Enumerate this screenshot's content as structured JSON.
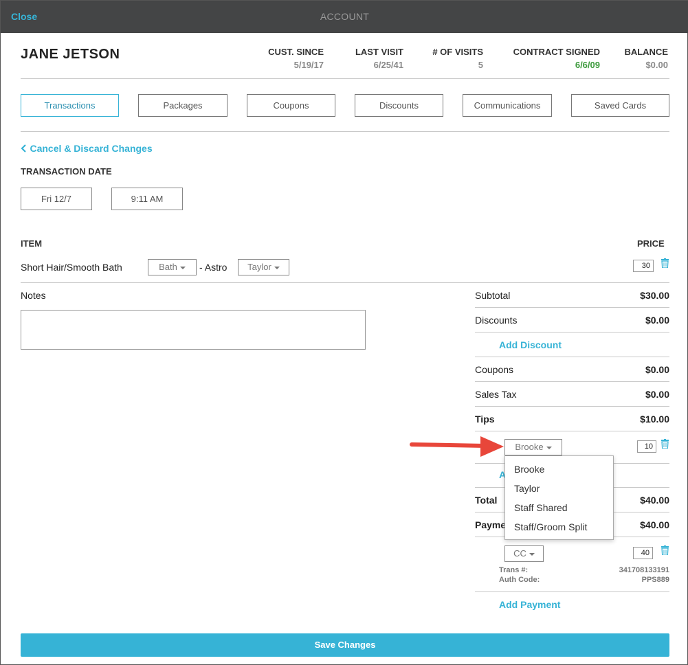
{
  "window": {
    "close_label": "Close",
    "title": "ACCOUNT"
  },
  "customer": {
    "name": "JANE JETSON",
    "stats": [
      {
        "label": "CUST. SINCE",
        "value": "5/19/17"
      },
      {
        "label": "LAST VISIT",
        "value": "6/25/41"
      },
      {
        "label": "# OF VISITS",
        "value": "5"
      },
      {
        "label": "CONTRACT SIGNED",
        "value": "6/6/09"
      },
      {
        "label": "BALANCE",
        "value": "$0.00"
      }
    ]
  },
  "tabs": [
    "Transactions",
    "Packages",
    "Coupons",
    "Discounts",
    "Communications",
    "Saved Cards"
  ],
  "active_tab": "Transactions",
  "cancel_label": "Cancel & Discard Changes",
  "transaction_date": {
    "label": "TRANSACTION DATE",
    "date": "Fri 12/7",
    "time": "9:11 AM"
  },
  "items": {
    "header_item": "ITEM",
    "header_price": "PRICE",
    "row": {
      "name": "Short Hair/Smooth Bath",
      "service": "Bath",
      "pet": "- Astro",
      "staff": "Taylor",
      "price": "30"
    }
  },
  "notes": {
    "label": "Notes",
    "value": ""
  },
  "summary": {
    "subtotal_label": "Subtotal",
    "subtotal": "$30.00",
    "discounts_label": "Discounts",
    "discounts": "$0.00",
    "add_discount": "Add Discount",
    "coupons_label": "Coupons",
    "coupons": "$0.00",
    "tax_label": "Sales Tax",
    "tax": "$0.00",
    "tips_label": "Tips",
    "tips": "$10.00",
    "tip_staff": "Brooke",
    "tip_amount": "10",
    "add_tip_partial": "A",
    "total_label": "Total",
    "total": "$40.00",
    "payments_label": "Payme",
    "payments": "$40.00",
    "payment_method": "CC",
    "payment_amount": "40",
    "trans_label": "Trans #:",
    "trans_value": "341708133191",
    "auth_label": "Auth Code:",
    "auth_value": "PPS889",
    "add_payment": "Add Payment"
  },
  "tip_dropdown": {
    "options": [
      "Brooke",
      "Taylor",
      "Staff Shared",
      "Staff/Groom Split"
    ]
  },
  "save_label": "Save Changes",
  "colors": {
    "accent": "#36b3d6",
    "titlebar": "#444546",
    "green": "#3c9a3c",
    "arrow": "#e8463a"
  }
}
